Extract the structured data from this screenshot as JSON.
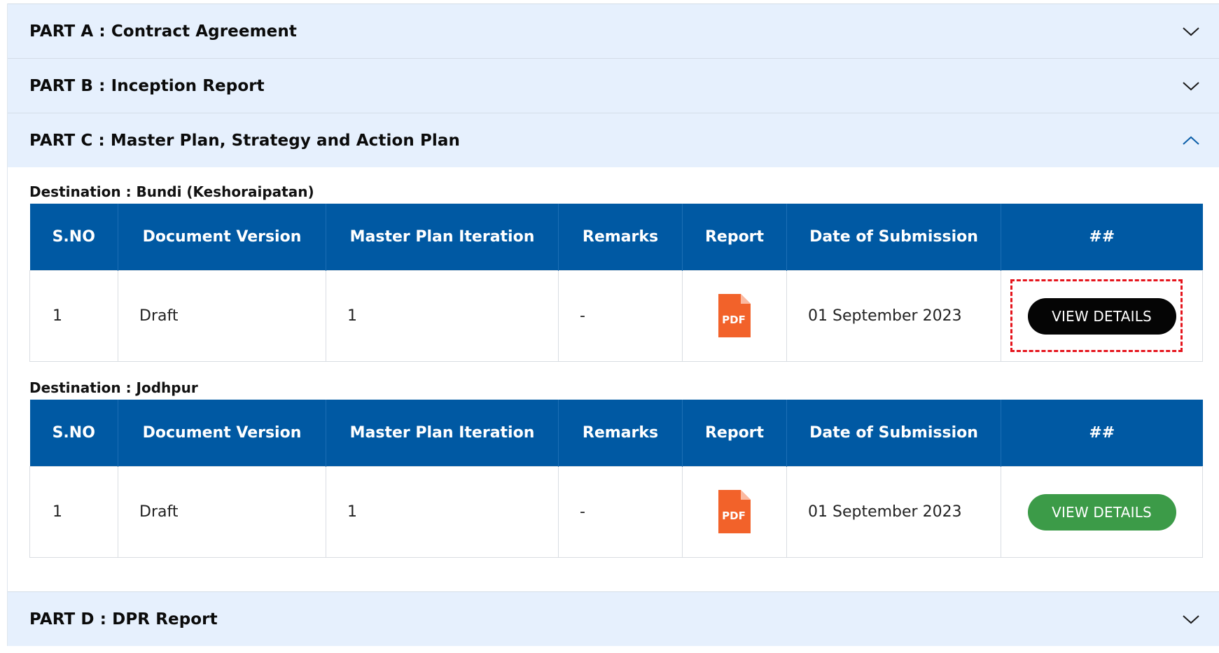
{
  "accordion": {
    "part_a": {
      "title": "PART A : Contract Agreement",
      "expanded": false
    },
    "part_b": {
      "title": "PART B : Inception Report",
      "expanded": false
    },
    "part_c": {
      "title": "PART C : Master Plan, Strategy and Action Plan",
      "expanded": true,
      "columns": [
        "S.NO",
        "Document Version",
        "Master Plan Iteration",
        "Remarks",
        "Report",
        "Date of Submission",
        "##"
      ],
      "destinations": [
        {
          "label": "Destination : Bundi (Keshoraipatan)",
          "rows": [
            {
              "sno": "1",
              "version": "Draft",
              "iteration": "1",
              "remarks": "-",
              "report_icon": "pdf-icon",
              "report_icon_text": "PDF",
              "date": "01 September 2023",
              "action": "VIEW DETAILS",
              "action_color": "#050505",
              "highlighted": true
            }
          ]
        },
        {
          "label": "Destination : Jodhpur",
          "rows": [
            {
              "sno": "1",
              "version": "Draft",
              "iteration": "1",
              "remarks": "-",
              "report_icon": "pdf-icon",
              "report_icon_text": "PDF",
              "date": "01 September 2023",
              "action": "VIEW DETAILS",
              "action_color": "#3c9b48",
              "highlighted": false
            }
          ]
        }
      ]
    },
    "part_d": {
      "title": "PART D : DPR Report",
      "expanded": false
    }
  },
  "colors": {
    "accordion_header_bg": "#e6f0fd",
    "table_header_bg": "#0059a3",
    "chevron_open": "#0a5ea8",
    "pdf_icon": "#f2622a",
    "highlight_border": "#e5141c"
  }
}
